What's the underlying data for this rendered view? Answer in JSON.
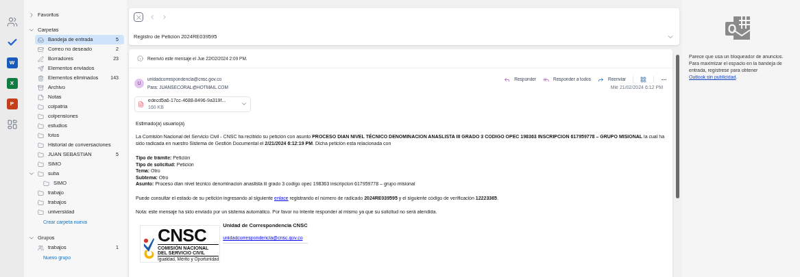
{
  "app_rail": [
    {
      "kind": "people"
    },
    {
      "kind": "todo"
    },
    {
      "kind": "office",
      "letter": "W",
      "color": "#185abd"
    },
    {
      "kind": "office",
      "letter": "X",
      "color": "#107c41"
    },
    {
      "kind": "office",
      "letter": "P",
      "color": "#c43e1c"
    },
    {
      "kind": "apps"
    }
  ],
  "sidebar": {
    "favorites": {
      "label": "Favoritos",
      "expanded": false
    },
    "folders": {
      "label": "Carpetas",
      "expanded": true,
      "new_folder": "Crear carpeta nueva",
      "items": [
        {
          "label": "Bandeja de entrada",
          "kind": "inbox",
          "count": "5",
          "selected": true
        },
        {
          "label": "Correo no deseado",
          "kind": "junk",
          "count": "2",
          "selected": false
        },
        {
          "label": "Borradores",
          "kind": "drafts",
          "count": "23",
          "selected": false
        },
        {
          "label": "Elementos enviados",
          "kind": "sent",
          "selected": false
        },
        {
          "label": "Elementos eliminados",
          "kind": "deleted",
          "count": "143",
          "selected": false
        },
        {
          "label": "Archivo",
          "kind": "archive",
          "selected": false
        },
        {
          "label": "Notas",
          "kind": "notes",
          "selected": false
        },
        {
          "label": "colpatria",
          "kind": "folder",
          "selected": false
        },
        {
          "label": "colpensiones",
          "kind": "folder",
          "selected": false
        },
        {
          "label": "estudios",
          "kind": "folder",
          "selected": false
        },
        {
          "label": "fotos",
          "kind": "folder",
          "selected": false
        },
        {
          "label": "Historial de conversaciones",
          "kind": "folder",
          "selected": false
        },
        {
          "label": "JUAN SEBASTIAN",
          "kind": "folder",
          "count": "5",
          "selected": false
        },
        {
          "label": "SIMO",
          "kind": "folder",
          "selected": false
        },
        {
          "label": "suba",
          "kind": "folder",
          "selected": false,
          "expanded": true,
          "children": [
            {
              "label": "SIMO",
              "kind": "folder",
              "selected": false
            }
          ]
        },
        {
          "label": "trabajo",
          "kind": "folder",
          "selected": false
        },
        {
          "label": "trabajos",
          "kind": "folder",
          "selected": false
        },
        {
          "label": "universidad",
          "kind": "folder",
          "selected": false
        }
      ]
    },
    "groups": {
      "label": "Grupos",
      "expanded": true,
      "new_group": "Nuevo grupo",
      "items": [
        {
          "label": "trabajos",
          "kind": "group",
          "count": "1",
          "selected": false
        }
      ]
    }
  },
  "reading_pane": {
    "subject": "Registro de Petición 2024RE039595",
    "message": {
      "info": "Reenvió este mensaje el Jue 22/02/2024 2:09 PM.",
      "avatar": "U",
      "from": "unidadcorrespondencia@cnsc.gov.co",
      "to": "Para: JUANSECORAL@HOTMAIL.COM",
      "actions": [
        {
          "label": "Responder",
          "kind": "reply"
        },
        {
          "label": "Responder a todos",
          "kind": "reply_all"
        },
        {
          "label": "Reenviar",
          "kind": "forward"
        }
      ],
      "date": "Mié 21/02/2024 6:12 PM",
      "attachment": {
        "name": "edecd5a6-17cc-4688-8496-9a319f...",
        "size": "160 KB"
      },
      "greeting": "Estimado(a) usuario(a)",
      "paragraph": "La Comisión Nacional del Servicio Civil - CNSC ha recibido su petición con asunto **PROCESO DIAN NIVEL TÉCNICO DENOMINACION ANASLISTA III GRADO 3 CODIGO OPEC 198363 INSCRIPCION 617959778 – GRUPO MISIONAL** la cual ha sido radicada en nuestro Sistema de Gestión Documental el **2/21/2024 6:12:19 PM**. Dicha petición esta relacionada con",
      "fields": [
        {
          "label": "Tipo de trámite:",
          "value": "Petición"
        },
        {
          "label": "Tipo de solicitud:",
          "value": "Petición"
        },
        {
          "label": "Tema:",
          "value": "Otro"
        },
        {
          "label": "Subtema:",
          "value": "Otro"
        },
        {
          "label": "Asunto:",
          "value": "Proceso dian nivel técnico denominacion anaslista iii grado 3 codigo opec 198363 inscripcion 617959778 – grupo misional"
        }
      ],
      "link_paragraph": {
        "before": "Puede consultar el estado de su petición ingresando al siguiente ",
        "link": "enlace",
        "after": " registrando el número de radicado **2024RE039595** y el siguiente código de verificación **12223365**."
      },
      "note": "Nota: este mensaje ha sido enviado por un sistema automático. Por favor no intente responder al mismo ya que su solicitud no será atendida.",
      "signature": {
        "name": "Unidad de Correspondencia CNSC",
        "email": "unidadcorrespondencia@cnsc.gov.co",
        "logo": {
          "acronym": "CNSC",
          "line1": "COMISIÓN NACIONAL",
          "line2": "DEL SERVICIO CIVIL",
          "motto": "Igualdad, Mérito y Oportunidad"
        }
      }
    }
  },
  "ad_pane": {
    "before": "Parece que usa un bloqueador de anuncios. Para maximizar el espacio en la bandeja de entrada, regístrese para obtener ",
    "link": "Outlook sin publicidad",
    "after": "."
  }
}
